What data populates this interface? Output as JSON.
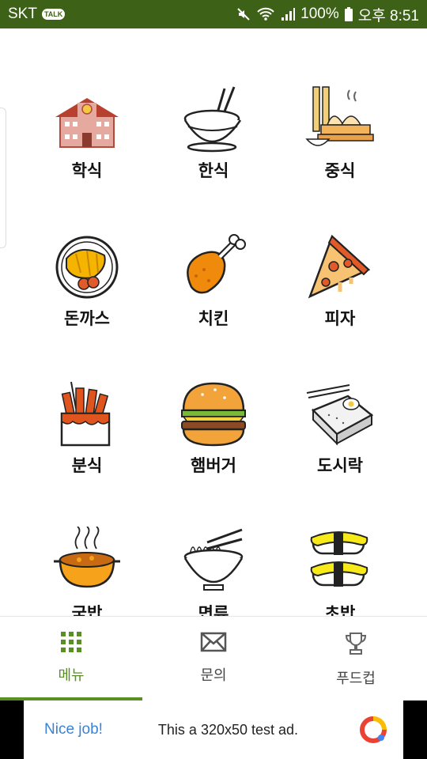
{
  "status_bar": {
    "carrier": "SKT",
    "talk_badge": "TALK",
    "battery": "100%",
    "time": "오후 8:51",
    "bg_color": "#3d6116"
  },
  "menu": {
    "items": [
      {
        "label": "학식",
        "icon": "school-building-icon"
      },
      {
        "label": "한식",
        "icon": "rice-bowl-icon"
      },
      {
        "label": "중식",
        "icon": "dumpling-steamer-icon"
      },
      {
        "label": "돈까스",
        "icon": "pork-cutlet-plate-icon"
      },
      {
        "label": "치킨",
        "icon": "chicken-drumstick-icon"
      },
      {
        "label": "피자",
        "icon": "pizza-slice-icon"
      },
      {
        "label": "분식",
        "icon": "fries-cup-icon"
      },
      {
        "label": "햄버거",
        "icon": "hamburger-icon"
      },
      {
        "label": "도시락",
        "icon": "lunchbox-icon"
      },
      {
        "label": "국밥",
        "icon": "soup-pot-icon"
      },
      {
        "label": "면류",
        "icon": "noodle-bowl-icon"
      },
      {
        "label": "초밥",
        "icon": "sushi-icon"
      }
    ]
  },
  "bottom_nav": {
    "tabs": [
      {
        "label": "메뉴",
        "icon": "grid-icon",
        "active": true
      },
      {
        "label": "문의",
        "icon": "mail-icon",
        "active": false
      },
      {
        "label": "푸드컵",
        "icon": "trophy-icon",
        "active": false
      }
    ],
    "accent_color": "#5a8f25"
  },
  "ad": {
    "nice_text": "Nice job!",
    "message": "This a 320x50 test ad."
  }
}
